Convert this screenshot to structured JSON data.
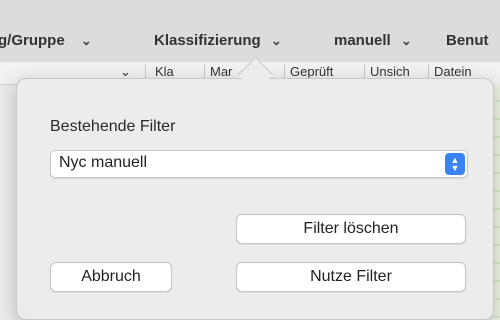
{
  "toolbar": {
    "items": [
      {
        "label": "g/Gruppe",
        "chevron": "⌄"
      },
      {
        "label": "Klassifizierung",
        "chevron": "⌄"
      },
      {
        "label": "manuell",
        "chevron": "⌄"
      },
      {
        "label": "Benut",
        "chevron": ""
      }
    ]
  },
  "table_header": {
    "columns": [
      "Kla",
      "Mar",
      "Geprüft",
      "Unsich",
      "Datein"
    ],
    "left_chevron": "⌄"
  },
  "popover": {
    "title": "Bestehende Filter",
    "select": {
      "value": "Nyc manuell",
      "stepper_icon": "up-down-chevrons"
    },
    "clear_button": "Filter löschen",
    "cancel_button": "Abbruch",
    "use_button": "Nutze Filter"
  },
  "colors": {
    "accent": "#3b82f6",
    "popover_bg": "#ececec"
  }
}
